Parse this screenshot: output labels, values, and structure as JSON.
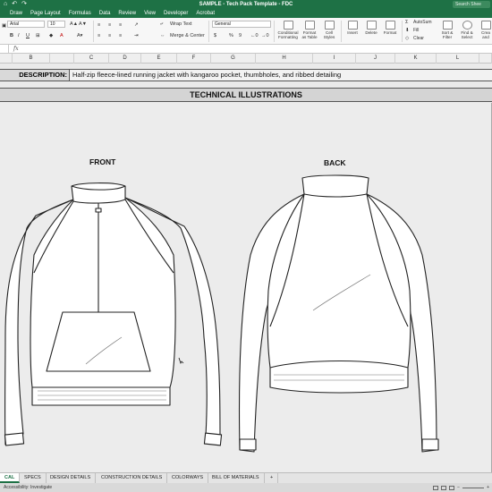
{
  "titlebar": {
    "quick_access": [
      "⌂",
      "↶",
      "↷"
    ],
    "doc_title": "SAMPLE - Tech Pack Template - FDC",
    "search_placeholder": "Search Shee"
  },
  "menu": {
    "tabs": [
      "Draw",
      "Page Layout",
      "Formulas",
      "Data",
      "Review",
      "View",
      "Developer",
      "Acrobat"
    ]
  },
  "ribbon": {
    "font_name": "Arial",
    "font_size": "10",
    "bold": "B",
    "italic": "I",
    "underline": "U",
    "wrap_text": "Wrap Text",
    "merge_center": "Merge & Center",
    "number_format": "General",
    "currency": "$",
    "percent": "%",
    "comma": "9",
    "conditional_formatting": "Conditional Formatting",
    "format_as_table": "Format as Table",
    "cell_styles": "Cell Styles",
    "insert": "Insert",
    "delete": "Delete",
    "format": "Format",
    "autosum": "AutoSum",
    "fill": "Fill",
    "clear": "Clear",
    "sort_filter": "Sort & Filter",
    "find_select": "Find & Select",
    "create": "Crea and"
  },
  "formula_bar": {
    "fx": "fx"
  },
  "columns": [
    "B",
    "C",
    "D",
    "E",
    "F",
    "G",
    "H",
    "I",
    "J",
    "K",
    "L"
  ],
  "sheet": {
    "description_label": "DESCRIPTION:",
    "description_value": "Half-zip fleece-lined running jacket with kangaroo pocket, thumbholes, and ribbed detailing",
    "section_title": "TECHNICAL ILLUSTRATIONS",
    "front_label": "FRONT",
    "back_label": "BACK"
  },
  "sheet_tabs": [
    "CAL",
    "SPECS",
    "DESIGN DETAILS",
    "CONSTRUCTION DETAILS",
    "COLORWAYS",
    "BILL OF MATERIALS",
    "+"
  ],
  "status": {
    "text": "Accessibility: Investigate"
  }
}
